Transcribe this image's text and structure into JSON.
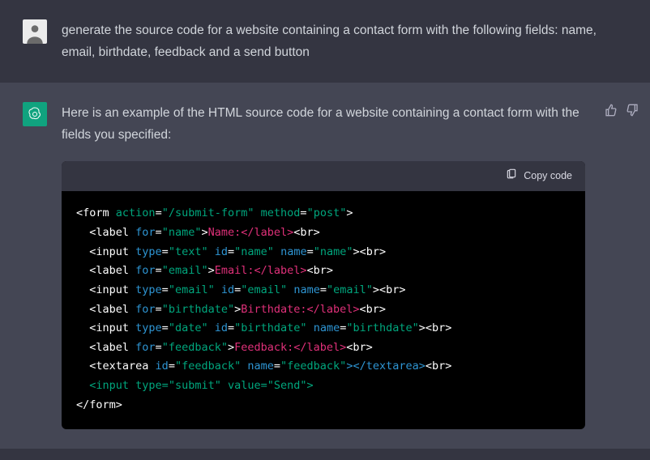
{
  "user_message": "generate the source code for a website containing a contact form with the following fields: name, email, birthdate, feedback and a send button",
  "assistant_intro": "Here is an example of the HTML source code for a website containing a contact form with the fields you specified:",
  "copy_label": "Copy code",
  "code": {
    "l1": {
      "open": "<form ",
      "a1": "action",
      "eq1": "=",
      "v1": "\"/submit-form\"",
      "sp": " ",
      "a2": "method",
      "eq2": "=",
      "v2": "\"post\"",
      "close": ">"
    },
    "l2": {
      "open": "  <label ",
      "a1": "for",
      "eq": "=",
      "v1": "\"name\"",
      "close": ">",
      "txt": "Name:",
      "end": "</label>",
      "br": "<br>"
    },
    "l3": {
      "open": "  <input ",
      "a1": "type",
      "eq1": "=",
      "v1": "\"text\"",
      "sp1": " ",
      "a2": "id",
      "eq2": "=",
      "v2": "\"name\"",
      "sp2": " ",
      "a3": "name",
      "eq3": "=",
      "v3": "\"name\"",
      "close": ">",
      "br": "<br>"
    },
    "l4": {
      "open": "  <label ",
      "a1": "for",
      "eq": "=",
      "v1": "\"email\"",
      "close": ">",
      "txt": "Email:",
      "end": "</label>",
      "br": "<br>"
    },
    "l5": {
      "open": "  <input ",
      "a1": "type",
      "eq1": "=",
      "v1": "\"email\"",
      "sp1": " ",
      "a2": "id",
      "eq2": "=",
      "v2": "\"email\"",
      "sp2": " ",
      "a3": "name",
      "eq3": "=",
      "v3": "\"email\"",
      "close": ">",
      "br": "<br>"
    },
    "l6": {
      "open": "  <label ",
      "a1": "for",
      "eq": "=",
      "v1": "\"birthdate\"",
      "close": ">",
      "txt": "Birthdate:",
      "end": "</label>",
      "br": "<br>"
    },
    "l7": {
      "open": "  <input ",
      "a1": "type",
      "eq1": "=",
      "v1": "\"date\"",
      "sp1": " ",
      "a2": "id",
      "eq2": "=",
      "v2": "\"birthdate\"",
      "sp2": " ",
      "a3": "name",
      "eq3": "=",
      "v3": "\"birthdate\"",
      "close": ">",
      "br": "<br>"
    },
    "l8": {
      "open": "  <label ",
      "a1": "for",
      "eq": "=",
      "v1": "\"feedback\"",
      "close": ">",
      "txt": "Feedback:",
      "end": "</label>",
      "br": "<br>"
    },
    "l9": {
      "open": "  <textarea ",
      "a1": "id",
      "eq1": "=",
      "v1": "\"feedback\"",
      "sp1": " ",
      "a2": "name",
      "eq2": "=",
      "v2": "\"feedback\"",
      "close": ">",
      "end": "</textarea>",
      "br": "<br>"
    },
    "l10": {
      "open": "  <input ",
      "a1": "type",
      "eq1": "=",
      "v1": "\"submit\"",
      "sp1": " ",
      "a2": "value",
      "eq2": "=",
      "v2": "\"Send\"",
      "close": ">"
    },
    "l11": {
      "open": "</form>"
    }
  }
}
